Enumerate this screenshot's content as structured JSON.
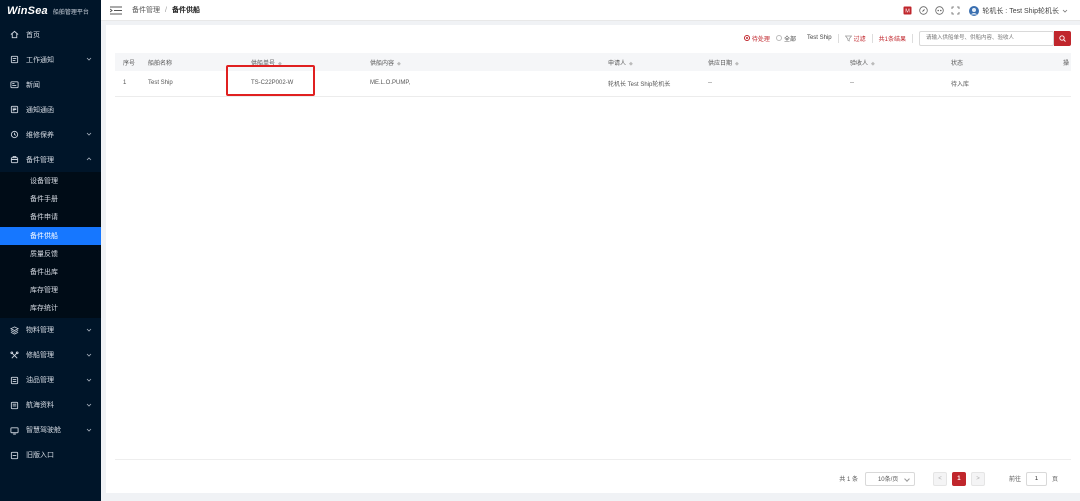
{
  "brand": {
    "name": "WinSea",
    "subtitle": "船舶管理平台"
  },
  "sidebar": {
    "items": [
      {
        "label": "首页",
        "icon": "home-icon"
      },
      {
        "label": "工作通知",
        "icon": "notice-icon",
        "expandable": true
      },
      {
        "label": "新闻",
        "icon": "news-icon"
      },
      {
        "label": "通知通函",
        "icon": "circular-icon"
      },
      {
        "label": "维修保养",
        "icon": "maintenance-icon",
        "expandable": true
      },
      {
        "label": "备件管理",
        "icon": "spareparts-icon",
        "expandable": true,
        "expanded": true
      },
      {
        "label": "物料管理",
        "icon": "materials-icon",
        "expandable": true
      },
      {
        "label": "修船管理",
        "icon": "repair-icon",
        "expandable": true
      },
      {
        "label": "油品管理",
        "icon": "oil-icon",
        "expandable": true
      },
      {
        "label": "航海资料",
        "icon": "navigation-icon",
        "expandable": true
      },
      {
        "label": "智慧驾驶舱",
        "icon": "dashboard-icon",
        "expandable": true
      },
      {
        "label": "旧版入口",
        "icon": "legacy-icon"
      }
    ],
    "submenu": [
      "设备管理",
      "备件手册",
      "备件申请",
      "备件供船",
      "质量反馈",
      "备件出库",
      "库存管理",
      "库存统计"
    ],
    "active_submenu": "备件供船"
  },
  "header": {
    "breadcrumb": [
      "备件管理",
      "备件供船"
    ],
    "separator": "/",
    "user": "轮机长 : Test Ship轮机长"
  },
  "toolbar": {
    "radio_pending": "待处理",
    "radio_all": "全部",
    "ship": "Test Ship",
    "filter": "过滤",
    "result": "共1条结果",
    "search_placeholder": "请输入供船单号、供船内容、验收人"
  },
  "table": {
    "columns": [
      "序号",
      "船舶名称",
      "供船单号",
      "供船内容",
      "申请人",
      "供应日期",
      "验收人",
      "状态",
      "操"
    ],
    "sortable": [
      false,
      false,
      true,
      true,
      true,
      true,
      true,
      false,
      false
    ],
    "rows": [
      [
        "1",
        "Test Ship",
        "TS-C22P002-W",
        "ME.L.O.PUMP,",
        "轮机长 Test Ship轮机长",
        "--",
        "--",
        "待入库",
        ""
      ]
    ]
  },
  "pagination": {
    "total": "共 1 条",
    "page_size": "10条/页",
    "prev": "<",
    "current": "1",
    "next": ">",
    "goto_label": "前往",
    "goto_value": "1",
    "page_suffix": "页"
  },
  "colors": {
    "accent": "#c0262c",
    "sidebar_bg": "#001529",
    "active": "#1677ff",
    "highlight": "#e02020"
  }
}
